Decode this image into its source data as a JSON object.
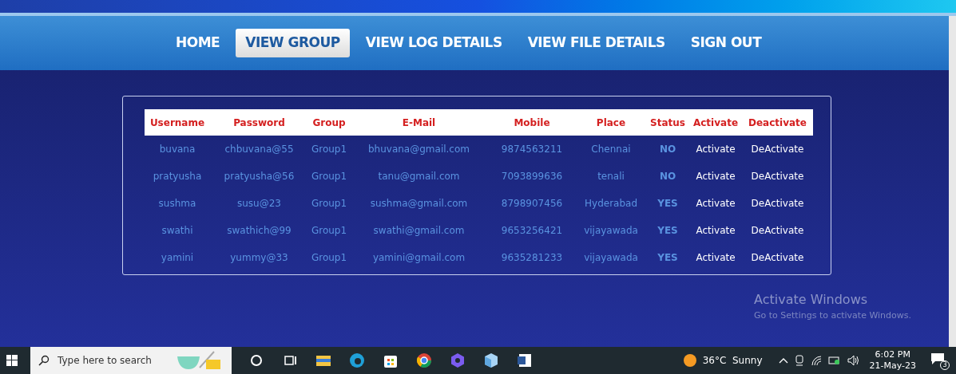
{
  "nav": [
    {
      "label": "HOME",
      "selected": false
    },
    {
      "label": "VIEW GROUP",
      "selected": true
    },
    {
      "label": "VIEW LOG DETAILS",
      "selected": false
    },
    {
      "label": "VIEW FILE DETAILS",
      "selected": false
    },
    {
      "label": "SIGN OUT",
      "selected": false
    }
  ],
  "table": {
    "columns": [
      "Username",
      "Password",
      "Group",
      "E-Mail",
      "Mobile",
      "Place",
      "Status",
      "Activate",
      "Deactivate"
    ],
    "rows": [
      [
        "buvana",
        "chbuvana@55",
        "Group1",
        "bhuvana@gmail.com",
        "9874563211",
        "Chennai",
        "NO",
        "Activate",
        "DeActivate"
      ],
      [
        "pratyusha",
        "pratyusha@56",
        "Group1",
        "tanu@gmail.com",
        "7093899636",
        "tenali",
        "NO",
        "Activate",
        "DeActivate"
      ],
      [
        "sushma",
        "susu@23",
        "Group1",
        "sushma@gmail.com",
        "8798907456",
        "Hyderabad",
        "YES",
        "Activate",
        "DeActivate"
      ],
      [
        "swathi",
        "swathich@99",
        "Group1",
        "swathi@gmail.com",
        "9653256421",
        "vijayawada",
        "YES",
        "Activate",
        "DeActivate"
      ],
      [
        "yamini",
        "yummy@33",
        "Group1",
        "yamini@gmail.com",
        "9635281233",
        "vijayawada",
        "YES",
        "Activate",
        "DeActivate"
      ]
    ]
  },
  "activation_notice": {
    "title": "Activate Windows",
    "text": "Go to Settings to activate Windows."
  },
  "taskbar": {
    "search_placeholder": "Type here to search",
    "weather": "36°C  Sunny",
    "time": "6:02 PM",
    "date": "21-May-23",
    "notifications": "3"
  }
}
